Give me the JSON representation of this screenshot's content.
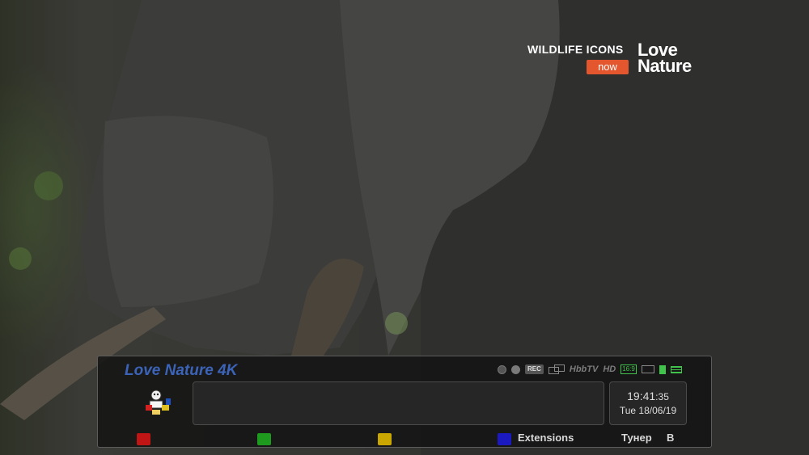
{
  "branding": {
    "show": "WILDLIFE ICONS",
    "now": "now",
    "logo_line1": "Love",
    "logo_line2": "Nature"
  },
  "infobar": {
    "channel_name": "Love Nature 4K",
    "status_icons": [
      "record-dot-icon",
      "rec-icon",
      "hbbtv-icon",
      "hd-icon",
      "aspect-16-9-icon",
      "subtitle-icon",
      "signal-icon",
      "teletext-icon"
    ],
    "status_text": {
      "rec": "REC",
      "hbbtv": "HbbTV",
      "hd": "HD",
      "aspect": "16:9"
    },
    "epg_now": "",
    "clock": {
      "time": "19:41",
      "seconds": "35",
      "date": "Tue 18/06/19"
    },
    "keys": {
      "red": "",
      "green": "",
      "yellow": "",
      "blue": "Extensions"
    },
    "tuner_label": "Тунер",
    "tuner_value": "B",
    "colors": {
      "red": "#c01515",
      "green": "#1e9a1e",
      "yellow": "#c9a700",
      "blue": "#1a1ac0",
      "channel": "#3b63b8"
    }
  }
}
